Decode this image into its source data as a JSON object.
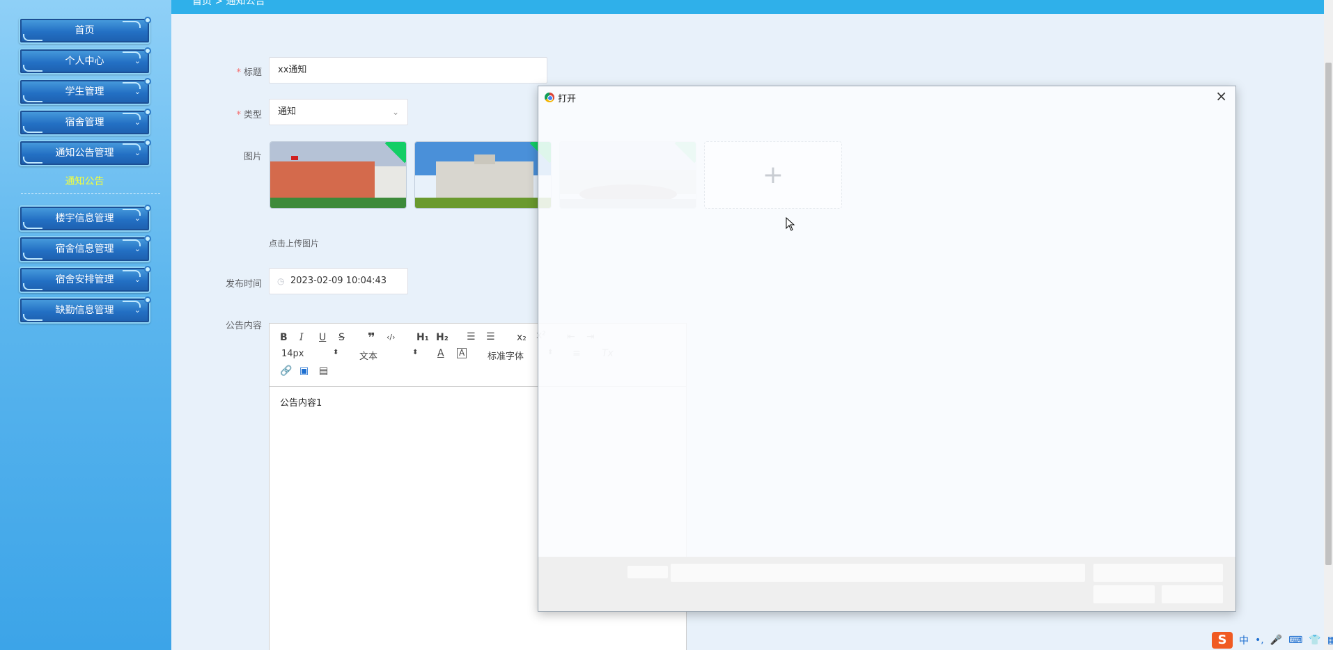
{
  "sidebar": {
    "items": [
      {
        "label": "首页"
      },
      {
        "label": "个人中心"
      },
      {
        "label": "学生管理"
      },
      {
        "label": "宿舍管理"
      },
      {
        "label": "通知公告管理"
      },
      {
        "label": "楼宇信息管理"
      },
      {
        "label": "宿舍信息管理"
      },
      {
        "label": "宿舍安排管理"
      },
      {
        "label": "缺勤信息管理"
      }
    ],
    "sub_item": "通知公告"
  },
  "topbar": {
    "breadcrumb": "首页 > 通知公告"
  },
  "form": {
    "title_label": "标题",
    "title_value": "xx通知",
    "type_label": "类型",
    "type_value": "通知",
    "image_label": "图片",
    "upload_tip": "点击上传图片",
    "publish_time_label": "发布时间",
    "publish_time_value": "2023-02-09 10:04:43",
    "content_label": "公告内容"
  },
  "editor": {
    "font_size": "14px",
    "block_type": "文本",
    "font_family": "标准字体",
    "content": "公告内容1"
  },
  "dialog": {
    "title": "打开"
  },
  "colors": {
    "sidebar_top": "#8fd0f7",
    "sidebar_bottom": "#3ca4e8",
    "nav_button": "#2370c4",
    "active_sub": "#f4ff3a",
    "topbar": "#2fb0ea",
    "required": "#f56c6c"
  },
  "ime": {
    "lang": "中"
  }
}
